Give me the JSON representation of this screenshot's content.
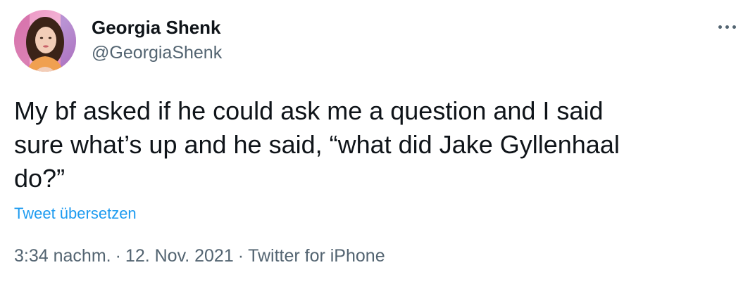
{
  "author": {
    "display_name": "Georgia Shenk",
    "handle": "@GeorgiaShenk",
    "avatar_icon": "profile-photo"
  },
  "more_icon": "more-horizontal-icon",
  "tweet": {
    "lines": [
      "My bf asked if he could ask me a question and I said",
      "sure what’s up and he said, “what did Jake Gyllenhaal",
      "do?”"
    ],
    "translate_label": "Tweet übersetzen"
  },
  "meta": {
    "time": "3:34 nachm.",
    "date": "12. Nov. 2021",
    "source": "Twitter for iPhone",
    "separator": "·"
  },
  "colors": {
    "text": "#0f1419",
    "secondary": "#536471",
    "link": "#1d9bf0"
  }
}
